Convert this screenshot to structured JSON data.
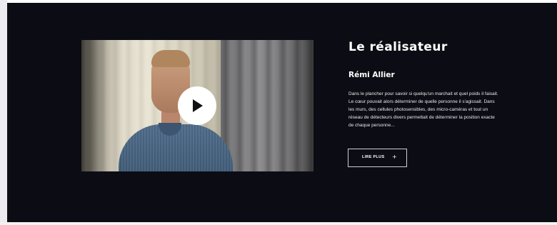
{
  "section": {
    "title": "Le réalisateur",
    "director_name": "Rémi Allier",
    "bio": "Dans le plancher pour savoir si quelqu'un marchait et quel poids il faisait. Le cœur pouvait alors déterminer de quelle personne il s'agissait. Dans les murs, des cellules photosensibles, des micro-caméras et tout un réseau de détecteurs divers permettait de déterminer la position exacte de chaque personne...",
    "read_more_label": "LIRE PLUS",
    "read_more_icon": "plus-icon"
  },
  "video": {
    "play_icon": "play-icon"
  },
  "colors": {
    "background": "#0c0d14",
    "text": "#ffffff",
    "button_border": "#cfcfd4"
  }
}
